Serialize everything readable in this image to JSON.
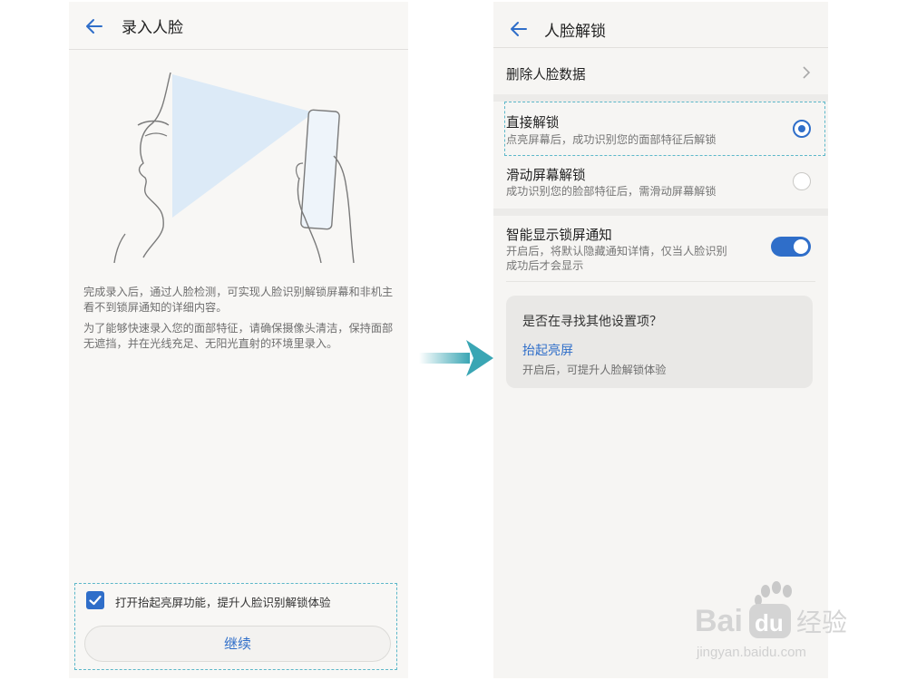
{
  "left": {
    "header": {
      "title": "录入人脸"
    },
    "description": [
      "完成录入后，通过人脸检测，可实现人脸识别解锁屏幕和非机主看不到锁屏通知的详细内容。",
      "为了能够快速录入您的面部特征，请确保摄像头清洁，保持面部无遮挡，并在光线充足、无阳光直射的环境里录入。"
    ],
    "checkbox": {
      "label": "打开抬起亮屏功能，提升人脸识别解锁体验",
      "checked": true
    },
    "continue_label": "继续"
  },
  "right": {
    "header": {
      "title": "人脸解锁"
    },
    "delete_face_data": "删除人脸数据",
    "direct_unlock": {
      "title": "直接解锁",
      "subtitle": "点亮屏幕后，成功识别您的面部特征后解锁",
      "selected": true
    },
    "slide_unlock": {
      "title": "滑动屏幕解锁",
      "subtitle": "成功识别您的脸部特征后，需滑动屏幕解锁",
      "selected": false
    },
    "smart_notify": {
      "title": "智能显示锁屏通知",
      "subtitle_line1": "开启后，将默认隐藏通知详情，仅当人脸识别",
      "subtitle_line2": "成功后才会显示",
      "enabled": true
    },
    "suggest": {
      "question": "是否在寻找其他设置项？",
      "link": "抬起亮屏",
      "subtitle": "开启后，可提升人脸解锁体验"
    }
  },
  "watermark": {
    "brand_a": "Bai",
    "brand_b": "du",
    "brand_c": "经验",
    "url": "jingyan.baidu.com"
  },
  "colors": {
    "accent": "#2f6ec9",
    "teal": "#3aa6b4",
    "dashed": "#5cb7c9"
  },
  "icons": [
    "back-arrow-icon",
    "chevron-right-icon",
    "check-icon",
    "paw-icon"
  ]
}
